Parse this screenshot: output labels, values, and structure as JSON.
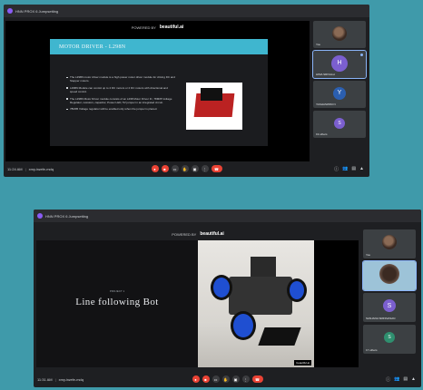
{
  "window1": {
    "title": "HNN PROX 6 Jumpsetting",
    "brand_prefix": "POWERED BY",
    "brand": "beautiful.ai",
    "slide_title": "MOTOR DRIVER - L298N",
    "bullets": [
      "The L298N motor driver module is a high power motor driver module for driving DC and Stepper motors.",
      "L298N Module can control up to 4 DC motors or 2 DC motors with directional and speed control.",
      "The L298N Motor Driver module consists of an L298 Motor Driver IC, 78M05 Voltage Regulator, resistors, capacitor, Power LED, 5V jumper in an integrated circuit.",
      "78M05 Voltage regulator will be enabled only when the jumper is placed."
    ],
    "time": "11:24 AM",
    "meeting_code": "xmy-twefe-mdq",
    "participants": [
      {
        "name": "You",
        "avatar": "photo"
      },
      {
        "name": "HIMA SRIVALLI",
        "initial": "H",
        "color": "#7b5fcf"
      },
      {
        "name": "YASHASWINI N",
        "initial": "Y",
        "color": "#2b5fb0"
      },
      {
        "name": "19 others",
        "initial": "S",
        "color": "#7b5fcf"
      }
    ]
  },
  "window2": {
    "title": "HNN PROX 6 Jumpsetting",
    "brand_prefix": "POWERED BY",
    "brand": "beautiful.ai",
    "slide_subtitle": "PROJECT 1",
    "slide_title": "Line following Bot",
    "photo_tag": "beautiful.ai",
    "time": "11:31 AM",
    "meeting_code": "xmy-twefe-mdq",
    "participants": [
      {
        "name": "You",
        "avatar": "photo"
      },
      {
        "name": "",
        "avatar": "camera"
      },
      {
        "name": "SANJANA SRINIVASAN",
        "initial": "S",
        "color": "#7b5fcf"
      },
      {
        "name": "17 others",
        "initial": "S",
        "color": "#2f8f6f"
      }
    ]
  }
}
